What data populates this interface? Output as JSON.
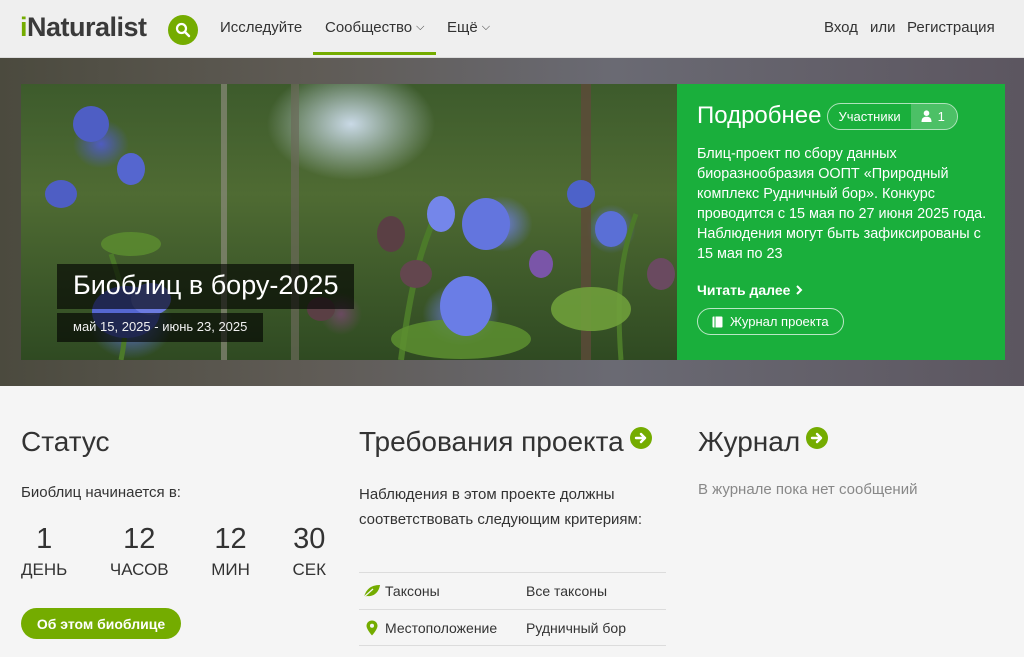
{
  "header": {
    "logo": {
      "prefix": "i",
      "rest": "Naturalist"
    },
    "nav": [
      {
        "label": "Исследуйте"
      },
      {
        "label": "Сообщество"
      },
      {
        "label": "Ещё"
      }
    ],
    "auth": {
      "login": "Вход",
      "or": "или",
      "signup": "Регистрация"
    },
    "accent_color": "#74ac00"
  },
  "hero": {
    "title": "Биоблиц в бору-2025",
    "dates": "май 15, 2025 - июнь 23, 2025",
    "panel": {
      "title": "Подробнее",
      "members_label": "Участники",
      "members_count": "1",
      "description": "Блиц-проект по сбору данных биоразнообразия ООПТ «Природный комплекс Рудничный бор». Конкурс проводится с 15 мая по 27 июня 2025 года. Наблюдения могут быть зафиксированы с 15 мая по 23",
      "read_more": "Читать далее",
      "journal_button": "Журнал проекта",
      "background_color": "#1aaf3c"
    }
  },
  "status": {
    "title": "Статус",
    "starts_label": "Биоблиц начинается в:",
    "countdown": [
      {
        "value": "1",
        "unit": "ДЕНЬ"
      },
      {
        "value": "12",
        "unit": "ЧАСОВ"
      },
      {
        "value": "12",
        "unit": "МИН"
      },
      {
        "value": "30",
        "unit": "СЕК"
      }
    ],
    "about_button": "Об этом биоблице"
  },
  "requirements": {
    "title": "Требования проекта",
    "text": "Наблюдения в этом проекте должны соответствовать следующим критериям:",
    "rows": [
      {
        "icon": "leaf-icon",
        "key": "Таксоны",
        "value": "Все таксоны"
      },
      {
        "icon": "map-pin-icon",
        "key": "Местоположение",
        "value": "Рудничный бор"
      }
    ]
  },
  "journal": {
    "title": "Журнал",
    "empty": "В журнале пока нет сообщений"
  }
}
